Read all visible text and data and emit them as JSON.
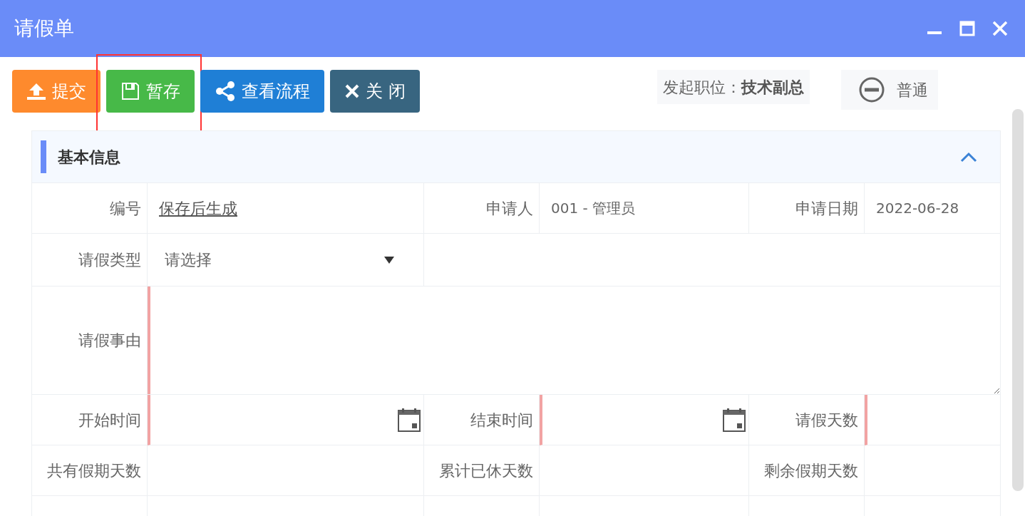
{
  "window": {
    "title": "请假单"
  },
  "toolbar": {
    "buttons": [
      {
        "kind": "submit",
        "label": "提交",
        "highlighted": false
      },
      {
        "kind": "save",
        "label": "暂存",
        "highlighted": true
      },
      {
        "kind": "flow",
        "label": "查看流程",
        "highlighted": false
      },
      {
        "kind": "close",
        "label": "关 闭",
        "highlighted": false
      }
    ],
    "position": {
      "label": "发起职位：",
      "value": "技术副总"
    },
    "priority": {
      "label": "普通"
    }
  },
  "section": {
    "title": "基本信息",
    "expanded": true
  },
  "rows": [
    {
      "kind": "fields",
      "cells": [
        {
          "label": "编号",
          "value": "保存后生成",
          "kind": "link",
          "required": false
        },
        {
          "label": "申请人",
          "value": "001 - 管理员",
          "kind": "text",
          "required": false
        },
        {
          "label": "申请日期",
          "value": "2022-06-28",
          "kind": "text",
          "required": false
        }
      ]
    },
    {
      "kind": "select",
      "cells": [
        {
          "label": "请假类型",
          "placeholder": "请选择",
          "kind": "select",
          "required": false
        }
      ]
    },
    {
      "kind": "textarea",
      "cells": [
        {
          "label": "请假事由",
          "kind": "textarea",
          "required": true
        }
      ]
    },
    {
      "kind": "fields",
      "cells": [
        {
          "label": "开始时间",
          "kind": "date",
          "required": true
        },
        {
          "label": "结束时间",
          "kind": "date",
          "required": true
        },
        {
          "label": "请假天数",
          "kind": "text",
          "required": true
        }
      ]
    },
    {
      "kind": "fields",
      "cells": [
        {
          "label": "共有假期天数",
          "kind": "text",
          "required": false
        },
        {
          "label": "累计已休天数",
          "kind": "text",
          "required": false
        },
        {
          "label": "剩余假期天数",
          "kind": "text",
          "required": false
        }
      ]
    },
    {
      "kind": "fields",
      "cells": []
    }
  ]
}
